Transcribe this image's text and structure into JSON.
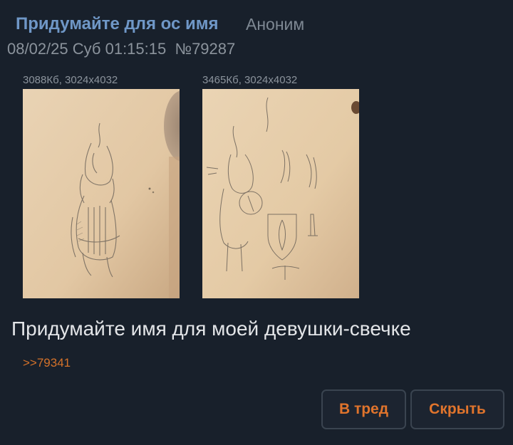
{
  "post": {
    "subject": "Придумайте для ос имя",
    "author": "Аноним",
    "date": "08/02/25 Суб 01:15:15",
    "number": "№79287",
    "files": [
      {
        "meta": "3088Кб, 3024x4032",
        "alt": "pencil sketch of candle character"
      },
      {
        "meta": "3465Кб, 3024x4032",
        "alt": "pencil sketches of candle character with shield and sword"
      }
    ],
    "message": "Придумайте имя для моей девушки-свечке",
    "reply_link": ">>79341"
  },
  "actions": {
    "to_thread": "В тред",
    "hide": "Скрыть"
  },
  "colors": {
    "background": "#18202b",
    "subject": "#6f97c7",
    "meta": "#8b939c",
    "accent": "#d4722a",
    "button_border": "#3a4450"
  }
}
